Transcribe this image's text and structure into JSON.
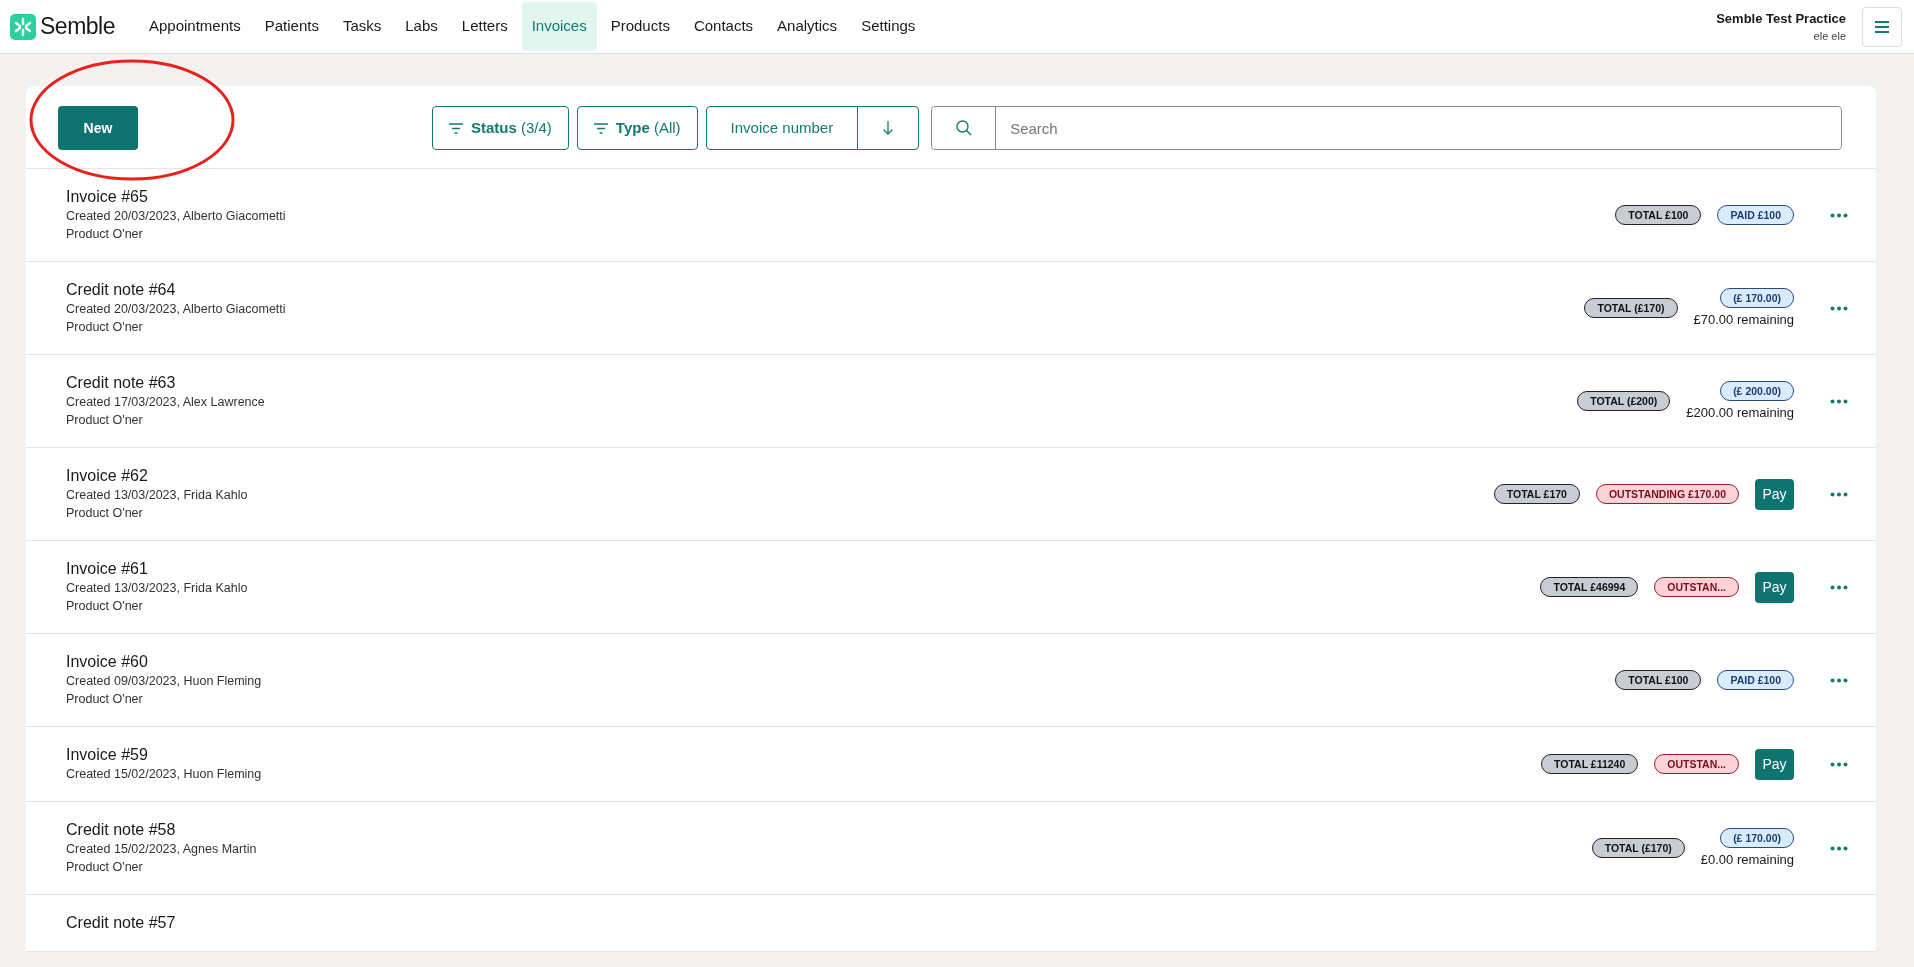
{
  "brand": {
    "name": "Semble"
  },
  "nav": [
    {
      "label": "Appointments",
      "selected": false
    },
    {
      "label": "Patients",
      "selected": false
    },
    {
      "label": "Tasks",
      "selected": false
    },
    {
      "label": "Labs",
      "selected": false
    },
    {
      "label": "Letters",
      "selected": false
    },
    {
      "label": "Invoices",
      "selected": true
    },
    {
      "label": "Products",
      "selected": false
    },
    {
      "label": "Contacts",
      "selected": false
    },
    {
      "label": "Analytics",
      "selected": false
    },
    {
      "label": "Settings",
      "selected": false
    }
  ],
  "account": {
    "practice": "Semble Test Practice",
    "user": "ele ele"
  },
  "toolbar": {
    "new_button": "New",
    "filters": [
      {
        "label": "Status",
        "value": "(3/4)"
      },
      {
        "label": "Type",
        "value": "(All)"
      }
    ],
    "sort": {
      "label": "Invoice number"
    },
    "search": {
      "placeholder": "Search"
    }
  },
  "rows": [
    {
      "title": "Invoice #65",
      "created": "Created 20/03/2023, Alberto Giacometti",
      "product": "Product O'ner",
      "tags": [
        {
          "kind": "total",
          "text": "TOTAL £100"
        },
        {
          "kind": "paid",
          "text": "PAID £100"
        }
      ]
    },
    {
      "title": "Credit note #64",
      "created": "Created 20/03/2023, Alberto Giacometti",
      "product": "Product O'ner",
      "tags": [
        {
          "kind": "total",
          "text": "TOTAL (£170)"
        },
        {
          "kind": "credit",
          "text": "(£ 170.00)",
          "remaining": "£70.00 remaining"
        }
      ]
    },
    {
      "title": "Credit note #63",
      "created": "Created 17/03/2023, Alex Lawrence",
      "product": "Product O'ner",
      "tags": [
        {
          "kind": "total",
          "text": "TOTAL (£200)"
        },
        {
          "kind": "credit",
          "text": "(£ 200.00)",
          "remaining": "£200.00 remaining"
        }
      ]
    },
    {
      "title": "Invoice #62",
      "created": "Created 13/03/2023, Frida Kahlo",
      "product": "Product O'ner",
      "tags": [
        {
          "kind": "total",
          "text": "TOTAL £170"
        },
        {
          "kind": "outstanding",
          "text": "OUTSTANDING £170.00"
        }
      ],
      "action": "Pay"
    },
    {
      "title": "Invoice #61",
      "created": "Created 13/03/2023, Frida Kahlo",
      "product": "Product O'ner",
      "tags": [
        {
          "kind": "total",
          "text": "TOTAL £46994"
        },
        {
          "kind": "outstanding",
          "text": "OUTSTAN..."
        }
      ],
      "action": "Pay"
    },
    {
      "title": "Invoice #60",
      "created": "Created 09/03/2023, Huon Fleming",
      "product": "Product O'ner",
      "tags": [
        {
          "kind": "total",
          "text": "TOTAL £100"
        },
        {
          "kind": "paid",
          "text": "PAID £100"
        }
      ]
    },
    {
      "title": "Invoice #59",
      "created": "Created 15/02/2023, Huon Fleming",
      "tags": [
        {
          "kind": "total",
          "text": "TOTAL £11240"
        },
        {
          "kind": "outstanding",
          "text": "OUTSTAN..."
        }
      ],
      "action": "Pay"
    },
    {
      "title": "Credit note #58",
      "created": "Created 15/02/2023, Agnes Martin",
      "product": "Product O'ner",
      "tags": [
        {
          "kind": "total",
          "text": "TOTAL (£170)"
        },
        {
          "kind": "credit",
          "text": "(£ 170.00)",
          "remaining": "£0.00 remaining"
        }
      ]
    },
    {
      "title": "Credit note #57"
    }
  ]
}
